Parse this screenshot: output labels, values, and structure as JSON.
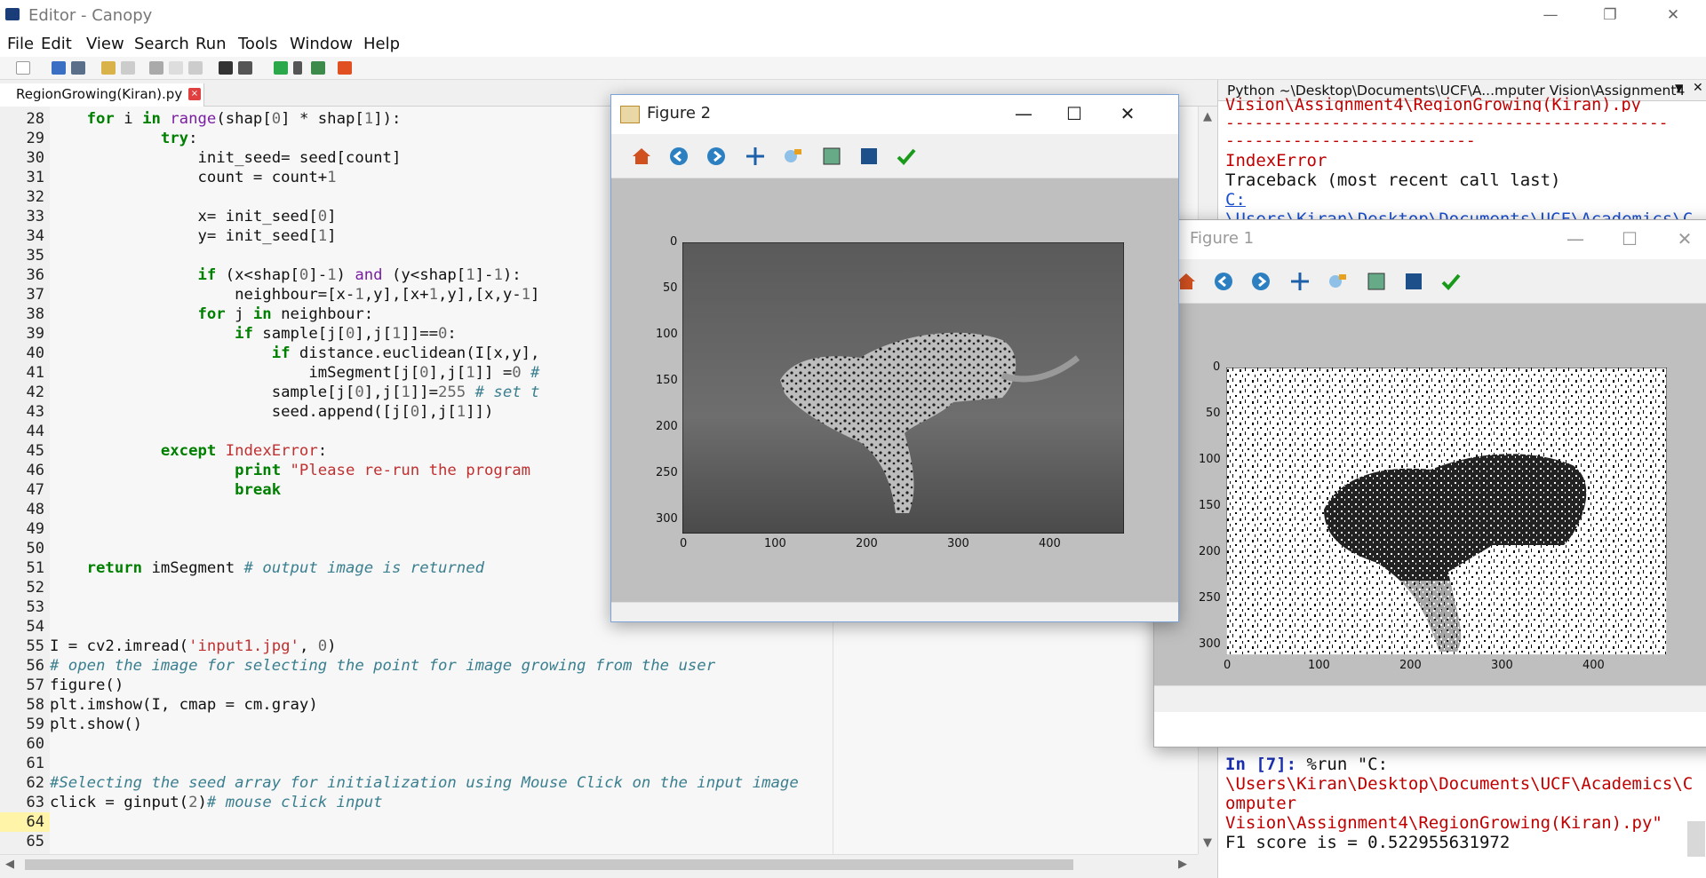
{
  "window": {
    "title": "Editor - Canopy",
    "controls": [
      "—",
      "❐",
      "✕"
    ]
  },
  "menu": [
    "File",
    "Edit",
    "View",
    "Search",
    "Run",
    "Tools",
    "Window",
    "Help"
  ],
  "tab": {
    "label": "RegionGrowing(Kiran).py",
    "close": "×"
  },
  "editor": {
    "line_numbers": [
      "28",
      "29",
      "30",
      "31",
      "32",
      "33",
      "34",
      "35",
      "36",
      "37",
      "38",
      "39",
      "40",
      "41",
      "42",
      "43",
      "44",
      "45",
      "46",
      "47",
      "48",
      "49",
      "50",
      "51",
      "52",
      "53",
      "54",
      "55",
      "56",
      "57",
      "58",
      "59",
      "60",
      "61",
      "62",
      "63",
      "64",
      "65"
    ],
    "current_line": "64"
  },
  "python_panel": {
    "header": "Python ~\\Desktop\\Documents\\UCF\\A...mputer Vision\\Assignment4",
    "lines_top": [
      "Vision\\Assignment4\\RegionGrowing(Kiran).py",
      "----------------------------------------------",
      "--------------------------",
      "IndexError",
      "Traceback (most recent call last)",
      "C:",
      "\\Users\\Kiran\\Desktop\\Documents\\UCF\\Academics\\C"
    ],
    "prompt": "In [7]:",
    "run_cmd": " %run \"C:",
    "run_path1": "\\Users\\Kiran\\Desktop\\Documents\\UCF\\Academics\\C",
    "run_path2": "omputer",
    "run_path3": "Vision\\Assignment4\\RegionGrowing(Kiran).py\"",
    "output": "F1 score is = 0.522955631972"
  },
  "figure2": {
    "title": "Figure 2",
    "yticks": [
      "0",
      "50",
      "100",
      "150",
      "200",
      "250",
      "300"
    ],
    "xticks": [
      "0",
      "100",
      "200",
      "300",
      "400"
    ]
  },
  "figure1": {
    "title": "Figure 1",
    "yticks": [
      "0",
      "50",
      "100",
      "150",
      "200",
      "250",
      "300"
    ],
    "xticks": [
      "0",
      "100",
      "200",
      "300",
      "400"
    ]
  }
}
